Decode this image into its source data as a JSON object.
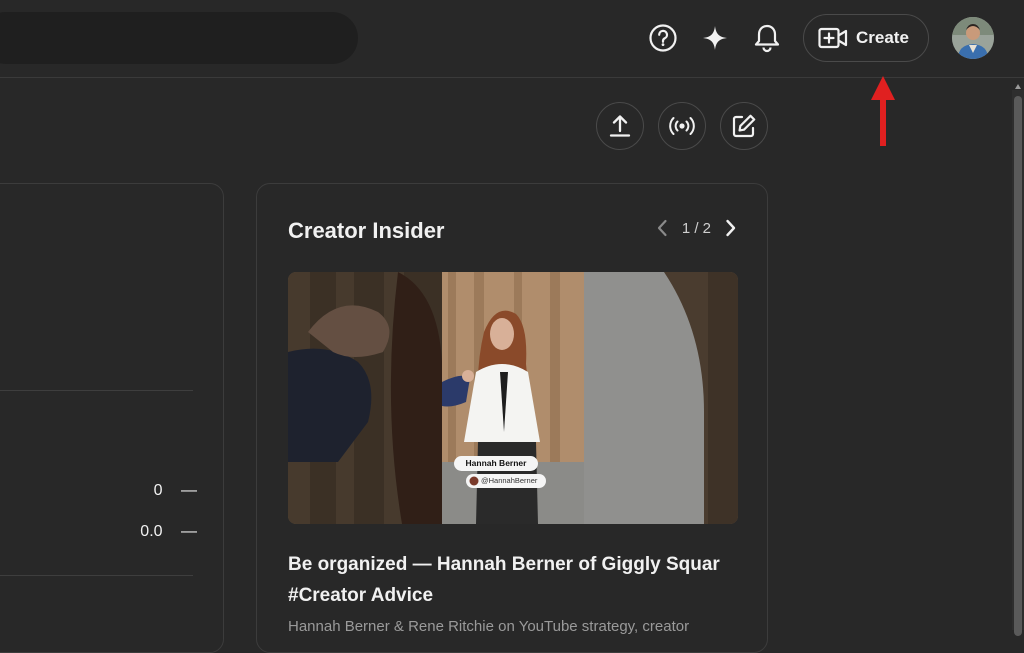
{
  "header": {
    "create_label": "Create"
  },
  "stats": [
    {
      "value": "0",
      "dash": "—"
    },
    {
      "value": "0.0",
      "dash": "—"
    }
  ],
  "creator_insider": {
    "title": "Creator Insider",
    "pager": "1 / 2",
    "thumbnail": {
      "name_tag": "Hannah Berner",
      "handle_tag": "@HannahBerner"
    },
    "video_title": "Be organized — Hannah Berner of Giggly Squar #Creator Advice",
    "video_description": "Hannah Berner & Rene Ritchie on YouTube strategy, creator"
  },
  "colors": {
    "background": "#282828",
    "annotation_arrow": "#e02020"
  },
  "icons": [
    "help-icon",
    "sparkle-icon",
    "bell-icon",
    "video-plus-icon",
    "upload-icon",
    "live-icon",
    "edit-icon",
    "chevron-left-icon",
    "chevron-right-icon"
  ]
}
